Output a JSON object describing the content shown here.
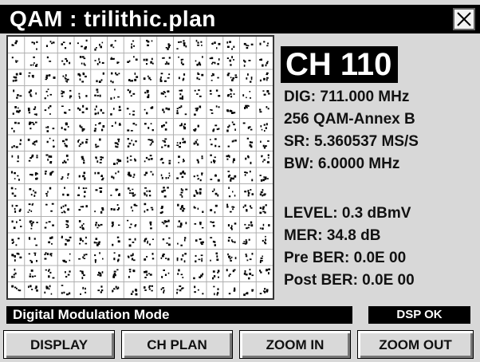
{
  "window": {
    "title": "QAM : trilithic.plan"
  },
  "channel": {
    "label": "CH 110",
    "dig": "DIG: 711.000 MHz",
    "modulation": "256 QAM-Annex B",
    "symbol_rate": "SR: 5.360537 MS/S",
    "bandwidth": "BW: 6.0000 MHz"
  },
  "measurements": {
    "level": "LEVEL:  0.3 dBmV",
    "mer": "MER: 34.8 dB",
    "pre_ber": "Pre BER: 0.0E 00",
    "post_ber": "Post BER: 0.0E 00"
  },
  "status": {
    "mode": "Digital Modulation Mode",
    "dsp": "DSP OK"
  },
  "buttons": {
    "display": "DISPLAY",
    "ch_plan": "CH PLAN",
    "zoom_in": "ZOOM IN",
    "zoom_out": "ZOOM OUT"
  },
  "constellation": {
    "grid": "16x16",
    "colors": {
      "dots": "#000000",
      "grid": "#b0b0b0",
      "background": "#ffffff"
    }
  },
  "icons": {
    "close": "close-icon"
  },
  "colors": {
    "titlebar": "#000000",
    "panel": "#d8d8d8",
    "text": "#111111"
  }
}
